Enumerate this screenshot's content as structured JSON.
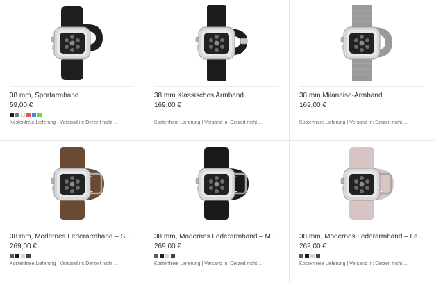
{
  "products": [
    {
      "title": "38 mm, Sportarmband",
      "price": "59,00 €",
      "shipping": "Kostenfreie Lieferung | Versand in: Derzeit nicht ...",
      "band_color": "#1f1f1f",
      "band_style": "sport",
      "swatches": [
        "#1a1a1a",
        "#7a7a7a",
        "#ffffff",
        "#e85a5a",
        "#3a8fd9",
        "#8cc84b"
      ]
    },
    {
      "title": "38 mm Klassisches Armband",
      "price": "169,00 €",
      "shipping": "Kostenfreie Lieferung | Versand in: Derzeit nicht ...",
      "band_color": "#1c1c1c",
      "band_style": "classic",
      "swatches": []
    },
    {
      "title": "38 mm Milanaise-Armband",
      "price": "169,00 €",
      "shipping": "Kostenfreie Lieferung | Versand in: Derzeit nicht ...",
      "band_color": "#9a9a9a",
      "band_style": "milanese",
      "swatches": []
    },
    {
      "title": "38 mm, Modernes Lederarmband – S...",
      "price": "269,00 €",
      "shipping": "Kostenfreie Lieferung | Versand in: Derzeit nicht ...",
      "band_color": "#6b4a33",
      "band_style": "modern",
      "swatches": [
        "#7a5236",
        "#1c1c1c",
        "#e6cfd0",
        "#39424f"
      ]
    },
    {
      "title": "38 mm, Modernes Lederarmband – M...",
      "price": "269,00 €",
      "shipping": "Kostenfreie Lieferung | Versand in: Derzeit nicht ...",
      "band_color": "#1a1a1a",
      "band_style": "modern",
      "swatches": [
        "#7a5236",
        "#1c1c1c",
        "#e6cfd0",
        "#39424f"
      ]
    },
    {
      "title": "38 mm, Modernes Lederarmband – La...",
      "price": "269,00 €",
      "shipping": "Kostenfreie Lieferung | Versand in: Derzeit nicht ...",
      "band_color": "#d9c4c4",
      "band_style": "modern",
      "swatches": [
        "#7a5236",
        "#1c1c1c",
        "#e6cfd0",
        "#39424f"
      ]
    }
  ]
}
